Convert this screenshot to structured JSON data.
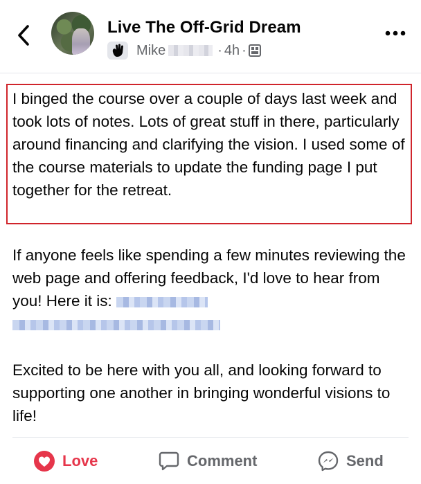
{
  "header": {
    "group_name": "Live The Off-Grid Dream",
    "author_first": "Mike",
    "time": "4h",
    "separator": "·"
  },
  "post": {
    "paragraph1": "I binged the course over a couple of days last week and took lots of notes. Lots of great stuff in there, particularly around financing and clarifying the vision. I used some of the course materials to update the funding page I put together for the retreat.",
    "paragraph2_text": "If anyone feels like spending a few minutes reviewing the web page and offering feedback, I'd love to hear from you! Here it is:",
    "paragraph3": "Excited to be here with you all, and looking forward to supporting one another in bringing wonderful visions to life!"
  },
  "actions": {
    "love_label": "Love",
    "comment_label": "Comment",
    "send_label": "Send"
  },
  "colors": {
    "love_red": "#e6364b",
    "highlight_border": "#d0242b",
    "meta_gray": "#65676b"
  },
  "icons": [
    "back-chevron-icon",
    "group-badge-icon",
    "photo-album-icon",
    "more-options-icon",
    "love-reaction-icon",
    "comment-bubble-icon",
    "messenger-send-icon"
  ]
}
